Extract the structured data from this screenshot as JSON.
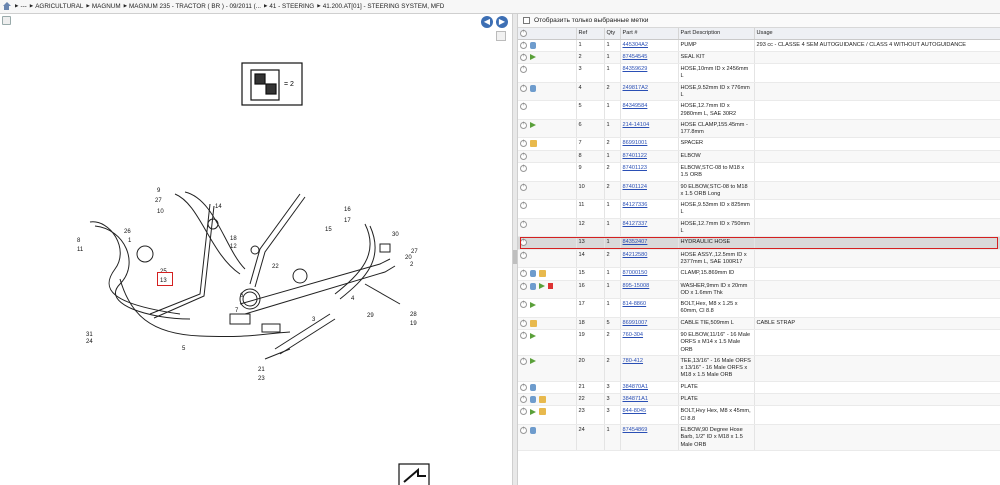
{
  "breadcrumb": [
    "---",
    "AGRICULTURAL",
    "MAGNUM",
    "MAGNUM 235 - TRACTOR ( BR ) - 09/2011 (...",
    "41 - STEERING",
    "41.200.AT[01] - STEERING SYSTEM, MFD"
  ],
  "diagram": {
    "kit_label": "= 2",
    "callouts": [
      "9",
      "27",
      "10",
      "14",
      "26",
      "1",
      "18",
      "8",
      "11",
      "25",
      "13",
      "12",
      "16",
      "15",
      "17",
      "30",
      "27",
      "20",
      "2",
      "22",
      "6",
      "7",
      "3",
      "4",
      "29",
      "28",
      "19",
      "31",
      "24",
      "5",
      "21",
      "23"
    ],
    "highlighted_callout": "13"
  },
  "filter": {
    "label": "Отобразить только выбранные метки"
  },
  "table": {
    "headers": [
      "",
      "Ref",
      "Qty",
      "Part #",
      "Part Description",
      "Usage"
    ],
    "rows": [
      {
        "icons": [
          "hand"
        ],
        "ref": "1",
        "qty": "1",
        "part": "445304A2",
        "desc": "PUMP",
        "usage": "293 cc - CLASSE 4 SEM AUTOGUIDANCE / CLASS 4 WITHOUT AUTOGUIDANCE"
      },
      {
        "icons": [
          "arrow"
        ],
        "ref": "2",
        "qty": "1",
        "part": "87454545",
        "desc": "SEAL KIT",
        "usage": ""
      },
      {
        "icons": [],
        "ref": "3",
        "qty": "1",
        "part": "84359629",
        "desc": "HOSE,10mm ID x 2456mm L",
        "usage": ""
      },
      {
        "icons": [
          "hand"
        ],
        "ref": "4",
        "qty": "2",
        "part": "249817A2",
        "desc": "HOSE,9.52mm ID x 776mm L",
        "usage": ""
      },
      {
        "icons": [],
        "ref": "5",
        "qty": "1",
        "part": "84349584",
        "desc": "HOSE,12.7mm ID x 2980mm L, SAE 30R2",
        "usage": ""
      },
      {
        "icons": [
          "arrow"
        ],
        "ref": "6",
        "qty": "1",
        "part": "214-14104",
        "desc": "HOSE CLAMP,155.45mm - 177.8mm",
        "usage": ""
      },
      {
        "icons": [
          "box"
        ],
        "ref": "7",
        "qty": "2",
        "part": "86991001",
        "desc": "SPACER",
        "usage": ""
      },
      {
        "icons": [],
        "ref": "8",
        "qty": "1",
        "part": "87401122",
        "desc": "ELBOW",
        "usage": ""
      },
      {
        "icons": [],
        "ref": "9",
        "qty": "2",
        "part": "87401123",
        "desc": "ELBOW,STC-08 to M18 x 1.5 ORB",
        "usage": ""
      },
      {
        "icons": [],
        "ref": "10",
        "qty": "2",
        "part": "87401124",
        "desc": "90 ELBOW,STC-08 to M18 x 1.5 ORB Long",
        "usage": ""
      },
      {
        "icons": [],
        "ref": "11",
        "qty": "1",
        "part": "84127336",
        "desc": "HOSE,9.53mm ID x 825mm L",
        "usage": ""
      },
      {
        "icons": [],
        "ref": "12",
        "qty": "1",
        "part": "84127337",
        "desc": "HOSE,12.7mm ID x 750mm L",
        "usage": ""
      },
      {
        "icons": [],
        "ref": "13",
        "qty": "1",
        "part": "84352407",
        "desc": "HYDRAULIC HOSE",
        "usage": "",
        "selected": true
      },
      {
        "icons": [],
        "ref": "14",
        "qty": "2",
        "part": "84212580",
        "desc": "HOSE ASSY.,12.5mm ID x 2377mm L, SAE 100R17",
        "usage": ""
      },
      {
        "icons": [
          "hand",
          "box"
        ],
        "ref": "15",
        "qty": "1",
        "part": "87000150",
        "desc": "CLAMP,15.869mm ID",
        "usage": ""
      },
      {
        "icons": [
          "hand",
          "arrow",
          "doc"
        ],
        "ref": "16",
        "qty": "1",
        "part": "895-15008",
        "desc": "WASHER,9mm ID x 20mm OD x 1.6mm Thk",
        "usage": ""
      },
      {
        "icons": [
          "arrow"
        ],
        "ref": "17",
        "qty": "1",
        "part": "814-8860",
        "desc": "BOLT,Hex, M8 x 1.25 x 60mm, Cl 8.8",
        "usage": ""
      },
      {
        "icons": [
          "box"
        ],
        "ref": "18",
        "qty": "5",
        "part": "86991007",
        "desc": "CABLE TIE,509mm L",
        "usage": "CABLE STRAP"
      },
      {
        "icons": [
          "arrow"
        ],
        "ref": "19",
        "qty": "2",
        "part": "760-304",
        "desc": "90 ELBOW,11/16\" - 16 Male ORFS x M14 x 1.5 Male ORB",
        "usage": ""
      },
      {
        "icons": [
          "arrow"
        ],
        "ref": "20",
        "qty": "2",
        "part": "780-412",
        "desc": "TEE,13/16\" - 16 Male ORFS x 13/16\" - 16 Male ORFS x M18 x 1.5 Male ORB",
        "usage": ""
      },
      {
        "icons": [
          "hand"
        ],
        "ref": "21",
        "qty": "3",
        "part": "384870A1",
        "desc": "PLATE",
        "usage": ""
      },
      {
        "icons": [
          "hand",
          "box"
        ],
        "ref": "22",
        "qty": "3",
        "part": "384871A1",
        "desc": "PLATE",
        "usage": ""
      },
      {
        "icons": [
          "arrow",
          "box"
        ],
        "ref": "23",
        "qty": "3",
        "part": "844-8045",
        "desc": "BOLT,Hvy Hex, M8 x 45mm, Cl 8.8",
        "usage": ""
      },
      {
        "icons": [
          "hand"
        ],
        "ref": "24",
        "qty": "1",
        "part": "87454869",
        "desc": "ELBOW,90 Degree Hose Barb, 1/2\" ID x M18 x 1.5 Male ORB",
        "usage": ""
      }
    ]
  }
}
